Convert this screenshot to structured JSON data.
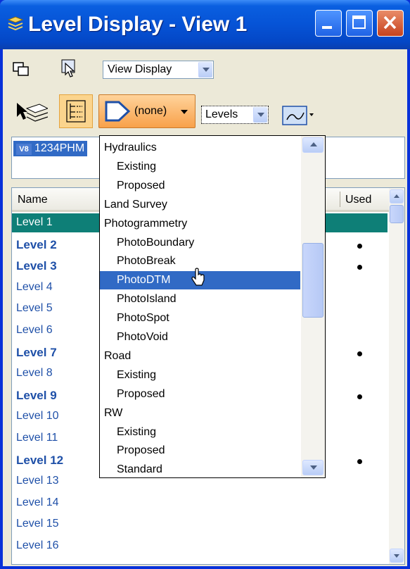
{
  "window": {
    "title": "Level Display - View 1",
    "accent": "#0653d6",
    "close_color": "#c6431e"
  },
  "toolbar": {
    "view_display_combo": "View Display",
    "filter_button_label": "(none)",
    "levels_combo": "Levels"
  },
  "model_field": {
    "badge": "V8",
    "value": "1234PHM"
  },
  "level_list": {
    "columns": {
      "name": "Name",
      "used": "Used"
    },
    "selected_color": "#0e7f77",
    "rows": [
      {
        "name": "Level 1",
        "bold": false,
        "used": false,
        "selected": true
      },
      {
        "name": "Level 2",
        "bold": true,
        "used": true,
        "selected": false
      },
      {
        "name": "Level 3",
        "bold": true,
        "used": true,
        "selected": false
      },
      {
        "name": "Level 4",
        "bold": false,
        "used": false,
        "selected": false
      },
      {
        "name": "Level 5",
        "bold": false,
        "used": false,
        "selected": false
      },
      {
        "name": "Level 6",
        "bold": false,
        "used": false,
        "selected": false
      },
      {
        "name": "Level 7",
        "bold": true,
        "used": true,
        "selected": false
      },
      {
        "name": "Level 8",
        "bold": false,
        "used": false,
        "selected": false
      },
      {
        "name": "Level 9",
        "bold": true,
        "used": true,
        "selected": false
      },
      {
        "name": "Level 10",
        "bold": false,
        "used": false,
        "selected": false
      },
      {
        "name": "Level 11",
        "bold": false,
        "used": false,
        "selected": false
      },
      {
        "name": "Level 12",
        "bold": true,
        "used": true,
        "selected": false
      },
      {
        "name": "Level 13",
        "bold": false,
        "used": false,
        "selected": false
      },
      {
        "name": "Level 14",
        "bold": false,
        "used": false,
        "selected": false
      },
      {
        "name": "Level 15",
        "bold": false,
        "used": false,
        "selected": false
      },
      {
        "name": "Level 16",
        "bold": false,
        "used": false,
        "selected": false
      }
    ]
  },
  "filter_dropdown": {
    "highlight_color": "#316ac5",
    "items": [
      {
        "label": "Hydraulics",
        "level": 0,
        "highlighted": false
      },
      {
        "label": "Existing",
        "level": 1,
        "highlighted": false
      },
      {
        "label": "Proposed",
        "level": 1,
        "highlighted": false
      },
      {
        "label": "Land Survey",
        "level": 0,
        "highlighted": false
      },
      {
        "label": "Photogrammetry",
        "level": 0,
        "highlighted": false
      },
      {
        "label": "PhotoBoundary",
        "level": 1,
        "highlighted": false
      },
      {
        "label": "PhotoBreak",
        "level": 1,
        "highlighted": false
      },
      {
        "label": "PhotoDTM",
        "level": 1,
        "highlighted": true
      },
      {
        "label": "PhotoIsland",
        "level": 1,
        "highlighted": false
      },
      {
        "label": "PhotoSpot",
        "level": 1,
        "highlighted": false
      },
      {
        "label": "PhotoVoid",
        "level": 1,
        "highlighted": false
      },
      {
        "label": "Road",
        "level": 0,
        "highlighted": false
      },
      {
        "label": "Existing",
        "level": 1,
        "highlighted": false
      },
      {
        "label": "Proposed",
        "level": 1,
        "highlighted": false
      },
      {
        "label": "RW",
        "level": 0,
        "highlighted": false
      },
      {
        "label": "Existing",
        "level": 1,
        "highlighted": false
      },
      {
        "label": "Proposed",
        "level": 1,
        "highlighted": false
      },
      {
        "label": "Standard",
        "level": 1,
        "highlighted": false
      }
    ]
  }
}
